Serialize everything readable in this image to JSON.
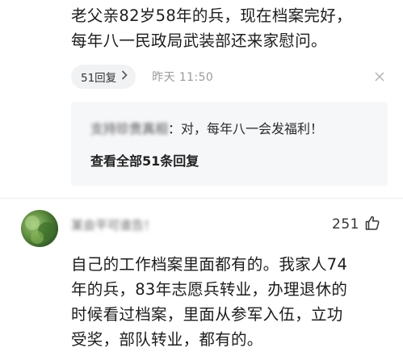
{
  "comment1": {
    "text_line1": "老父亲82岁58年的兵，现在档案完好，",
    "text_line2": "每年八一民政局武装部还来家慰问。",
    "reply_chip_label": "51回复",
    "time": "昨天 11:50",
    "close_icon": "close-icon",
    "sub_reply": {
      "author": "支持珍贵真相",
      "text": "：对，每年八一会发福利！",
      "see_all": "查看全部51条回复"
    }
  },
  "comment2": {
    "author": "某会平可谁告！",
    "likes": "251",
    "like_icon": "thumbs-up-icon",
    "text_line1": "自己的工作档案里面都有的。我家人74",
    "text_line2": "年的兵，83年志愿兵转业，办理退休的",
    "text_line3": "时候看过档案，里面从参军入伍，立功",
    "text_line4": "受奖，部队转业，都有的。"
  }
}
